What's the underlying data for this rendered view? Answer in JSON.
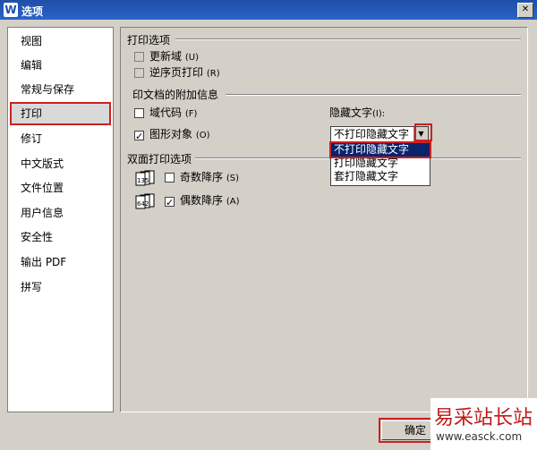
{
  "window": {
    "title": "选项",
    "app_icon": "wps-writer-icon",
    "close_label": "✕"
  },
  "sidebar": {
    "items": [
      {
        "label": "视图"
      },
      {
        "label": "编辑"
      },
      {
        "label": "常规与保存"
      },
      {
        "label": "打印",
        "active": true
      },
      {
        "label": "修订"
      },
      {
        "label": "中文版式"
      },
      {
        "label": "文件位置"
      },
      {
        "label": "用户信息"
      },
      {
        "label": "安全性"
      },
      {
        "label": "输出 PDF"
      },
      {
        "label": "拼写"
      }
    ]
  },
  "print_options": {
    "title": "打印选项",
    "update_fields": {
      "label": "更新域",
      "hotkey": "(U)",
      "checked": false,
      "enabled": false
    },
    "reverse_order": {
      "label": "逆序页打印",
      "hotkey": "(R)",
      "checked": false,
      "enabled": false
    }
  },
  "extra_info": {
    "title": "印文档的附加信息",
    "field_codes": {
      "label": "域代码",
      "hotkey": "(F)",
      "checked": false
    },
    "drawing_objects": {
      "label": "图形对象",
      "hotkey": "(O)",
      "checked": true
    },
    "hidden_text": {
      "label": "隐藏文字",
      "hotkey": "(I):",
      "selected": "不打印隐藏文字",
      "options": [
        "不打印隐藏文字",
        "打印隐藏文字",
        "套打隐藏文字"
      ]
    }
  },
  "duplex": {
    "title": "双面打印选项",
    "odd_desc": {
      "label": "奇数降序",
      "hotkey": "(S)",
      "checked": false,
      "icon_digits": "135"
    },
    "even_desc": {
      "label": "偶数降序",
      "hotkey": "(A)",
      "checked": true,
      "icon_digits": "642"
    }
  },
  "footer": {
    "ok_label": "确定"
  },
  "watermark": {
    "chars": "易采站长站",
    "url": "www.easck.com"
  },
  "colors": {
    "titlebar": "#2a63c9",
    "highlight": "#cc2020",
    "selection": "#0a246a"
  }
}
